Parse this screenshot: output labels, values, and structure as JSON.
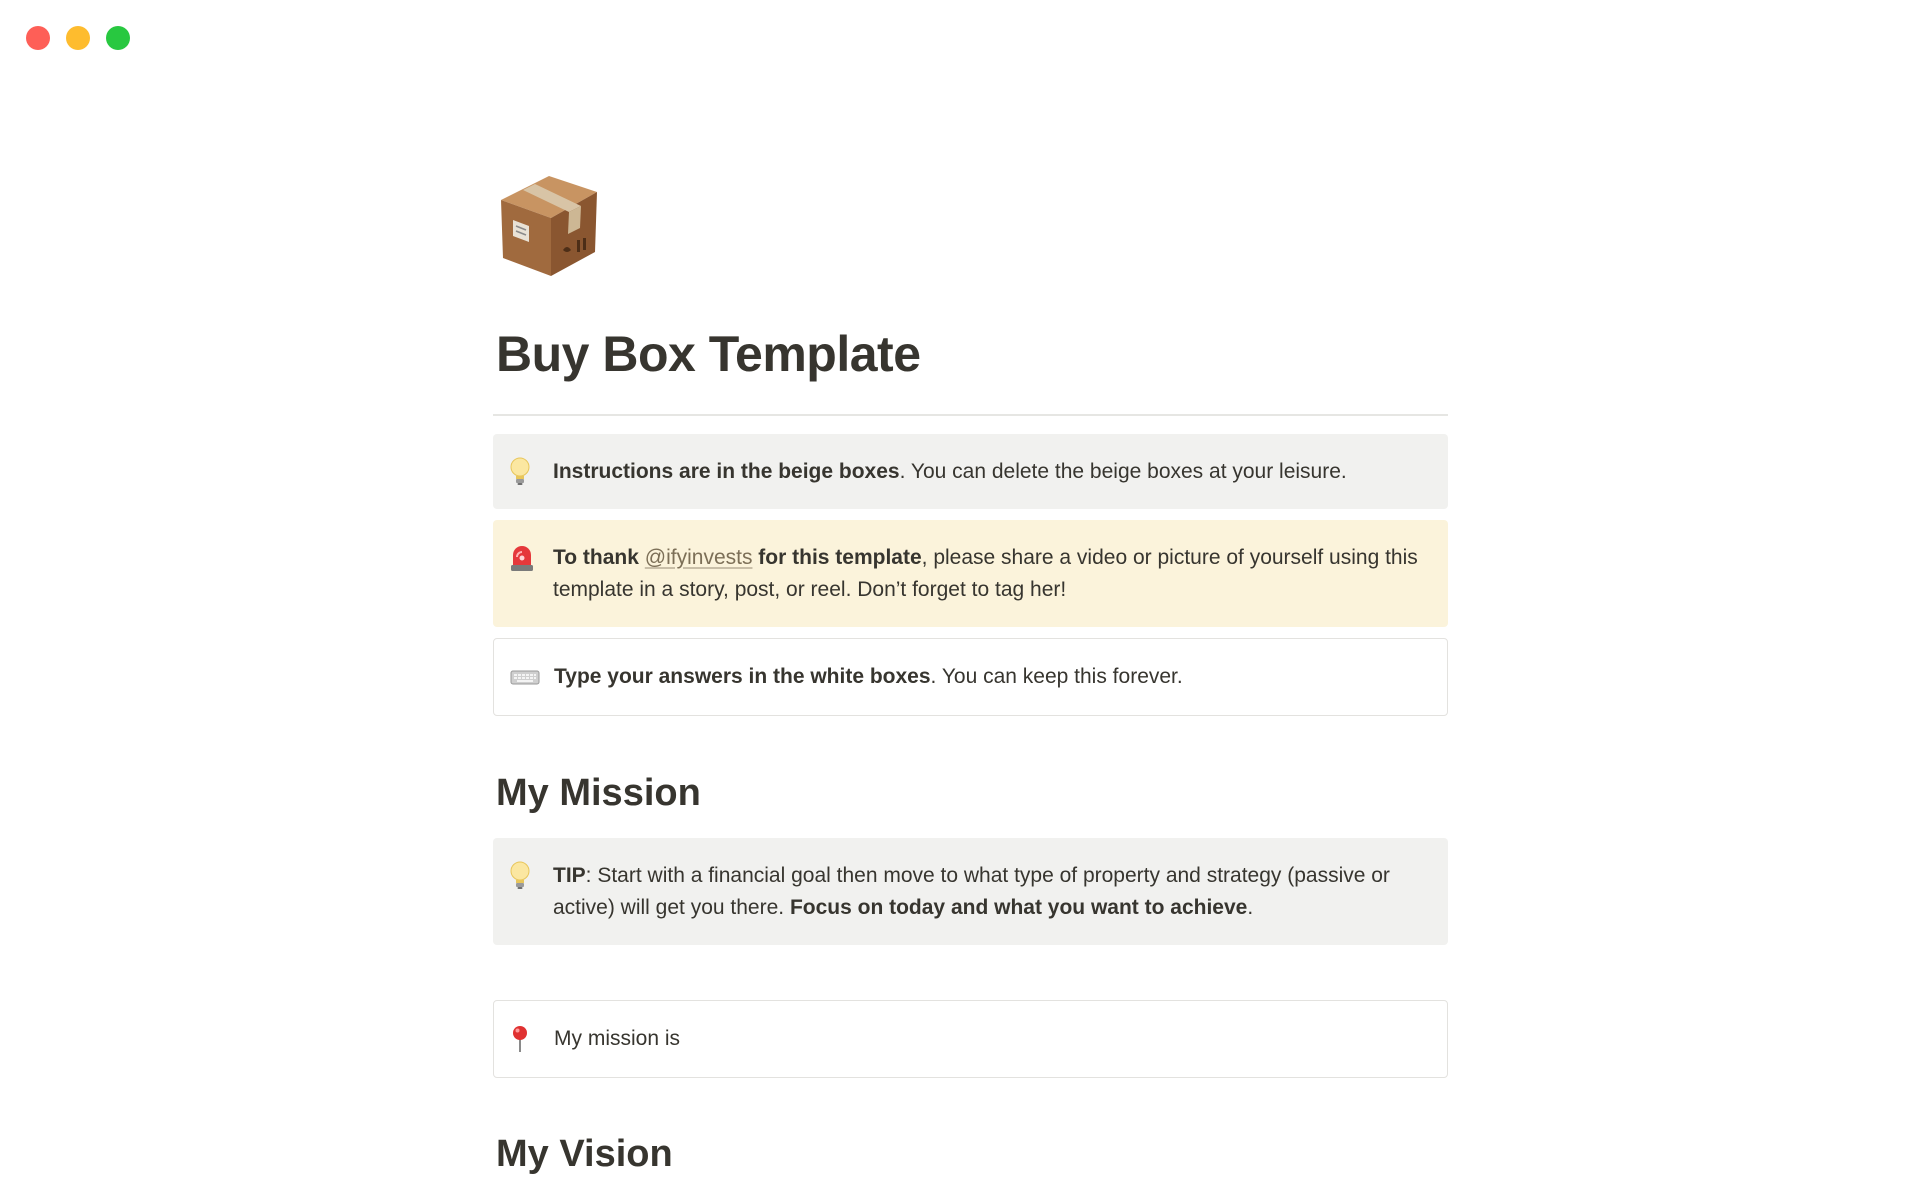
{
  "window": {
    "controls": [
      "close",
      "minimize",
      "maximize"
    ]
  },
  "page": {
    "icon": "package-box-icon",
    "title": "Buy Box Template"
  },
  "callouts": [
    {
      "icon": "lightbulb-icon",
      "bold": "Instructions are in the beige boxes",
      "rest": ". You can delete the beige boxes at your leisure."
    },
    {
      "icon": "siren-icon",
      "bold_a": "To thank ",
      "mention": "@ifyinvests",
      "bold_b": " for this template",
      "rest": ", please share a video or picture of yourself using this template in a story, post, or reel. Don’t forget to tag her!"
    },
    {
      "icon": "keyboard-icon",
      "bold": "Type your answers in the white boxes",
      "rest": ". You can keep this forever."
    }
  ],
  "mission": {
    "heading": "My Mission",
    "tip": {
      "icon": "lightbulb-icon",
      "bold": "TIP",
      "text": ": Start with a financial goal then move to what type of property and strategy (passive or active) will get you there. ",
      "bold_end": "Focus on today and what you want to achieve",
      "end": "."
    },
    "answer": {
      "icon": "round-pushpin-icon",
      "text": "My mission is"
    }
  },
  "vision": {
    "heading": "My Vision"
  },
  "colors": {
    "text": "#37352f",
    "gray_callout": "#f1f1ef",
    "beige_callout": "#fbf3db",
    "white_border": "#e3e2df"
  }
}
